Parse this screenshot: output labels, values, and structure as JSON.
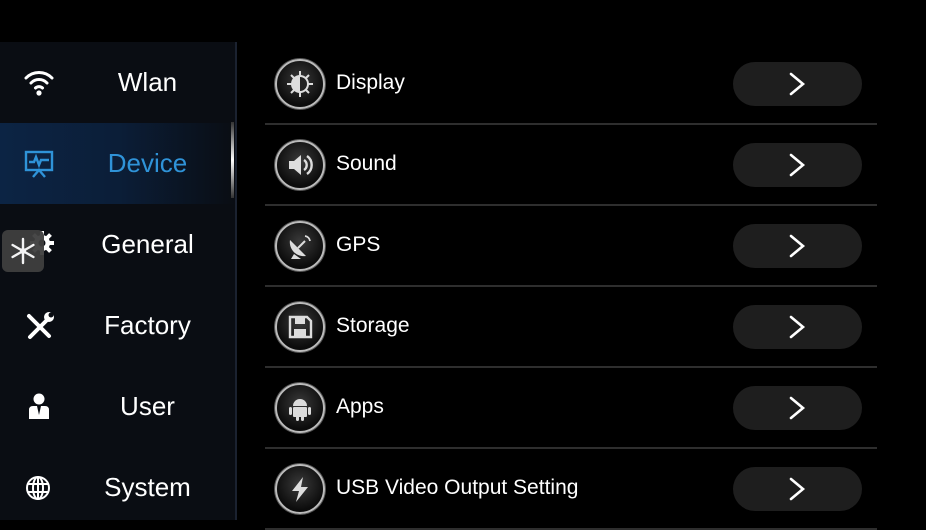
{
  "colors": {
    "accent": "#2f93d8",
    "background": "#000000",
    "sidebar": "#0a0d13",
    "button": "#1e1e1e"
  },
  "sidebar": {
    "active_index": 1,
    "items": [
      {
        "label": "Wlan",
        "icon": "wifi-icon"
      },
      {
        "label": "Device",
        "icon": "monitor-pulse-icon"
      },
      {
        "label": "General",
        "icon": "gear-icon"
      },
      {
        "label": "Factory",
        "icon": "tools-icon"
      },
      {
        "label": "User",
        "icon": "user-suit-icon"
      },
      {
        "label": "System",
        "icon": "globe-icon"
      }
    ]
  },
  "floating_badge": {
    "icon": "snowflake-icon"
  },
  "main": {
    "rows": [
      {
        "label": "Display",
        "icon": "brightness-icon",
        "action_icon": "chevron-right-icon"
      },
      {
        "label": "Sound",
        "icon": "speaker-icon",
        "action_icon": "chevron-right-icon"
      },
      {
        "label": "GPS",
        "icon": "satellite-dish-icon",
        "action_icon": "chevron-right-icon"
      },
      {
        "label": "Storage",
        "icon": "floppy-disk-icon",
        "action_icon": "chevron-right-icon"
      },
      {
        "label": "Apps",
        "icon": "android-icon",
        "action_icon": "chevron-right-icon"
      },
      {
        "label": "USB Video Output Setting",
        "icon": "lightning-icon",
        "action_icon": "chevron-right-icon"
      }
    ]
  }
}
